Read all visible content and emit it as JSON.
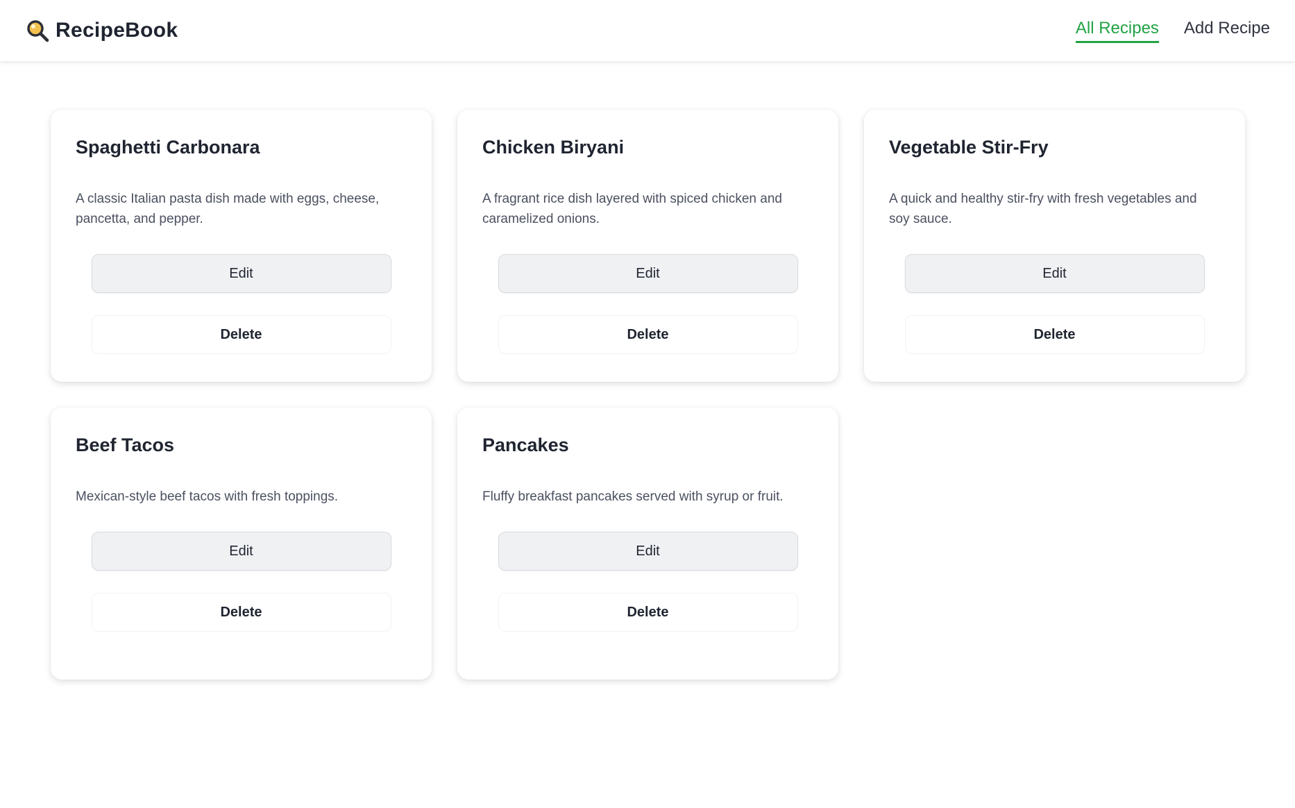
{
  "header": {
    "brand_icon": "magnifier-icon",
    "brand_name": "RecipeBook",
    "nav": [
      {
        "label": "All Recipes",
        "active": true
      },
      {
        "label": "Add Recipe",
        "active": false
      }
    ]
  },
  "colors": {
    "accent": "#22a244",
    "text": "#1f2430",
    "muted_text": "#4b5060",
    "edit_button_bg": "#f0f1f3",
    "card_bg": "#ffffff"
  },
  "recipes": [
    {
      "title": "Spaghetti Carbonara",
      "description": "A classic Italian pasta dish made with eggs, cheese, pancetta, and pepper.",
      "edit_label": "Edit",
      "delete_label": "Delete"
    },
    {
      "title": "Chicken Biryani",
      "description": "A fragrant rice dish layered with spiced chicken and caramelized onions.",
      "edit_label": "Edit",
      "delete_label": "Delete"
    },
    {
      "title": "Vegetable Stir-Fry",
      "description": "A quick and healthy stir-fry with fresh vegetables and soy sauce.",
      "edit_label": "Edit",
      "delete_label": "Delete"
    },
    {
      "title": "Beef Tacos",
      "description": "Mexican-style beef tacos with fresh toppings.",
      "edit_label": "Edit",
      "delete_label": "Delete"
    },
    {
      "title": "Pancakes",
      "description": "Fluffy breakfast pancakes served with syrup or fruit.",
      "edit_label": "Edit",
      "delete_label": "Delete"
    }
  ]
}
